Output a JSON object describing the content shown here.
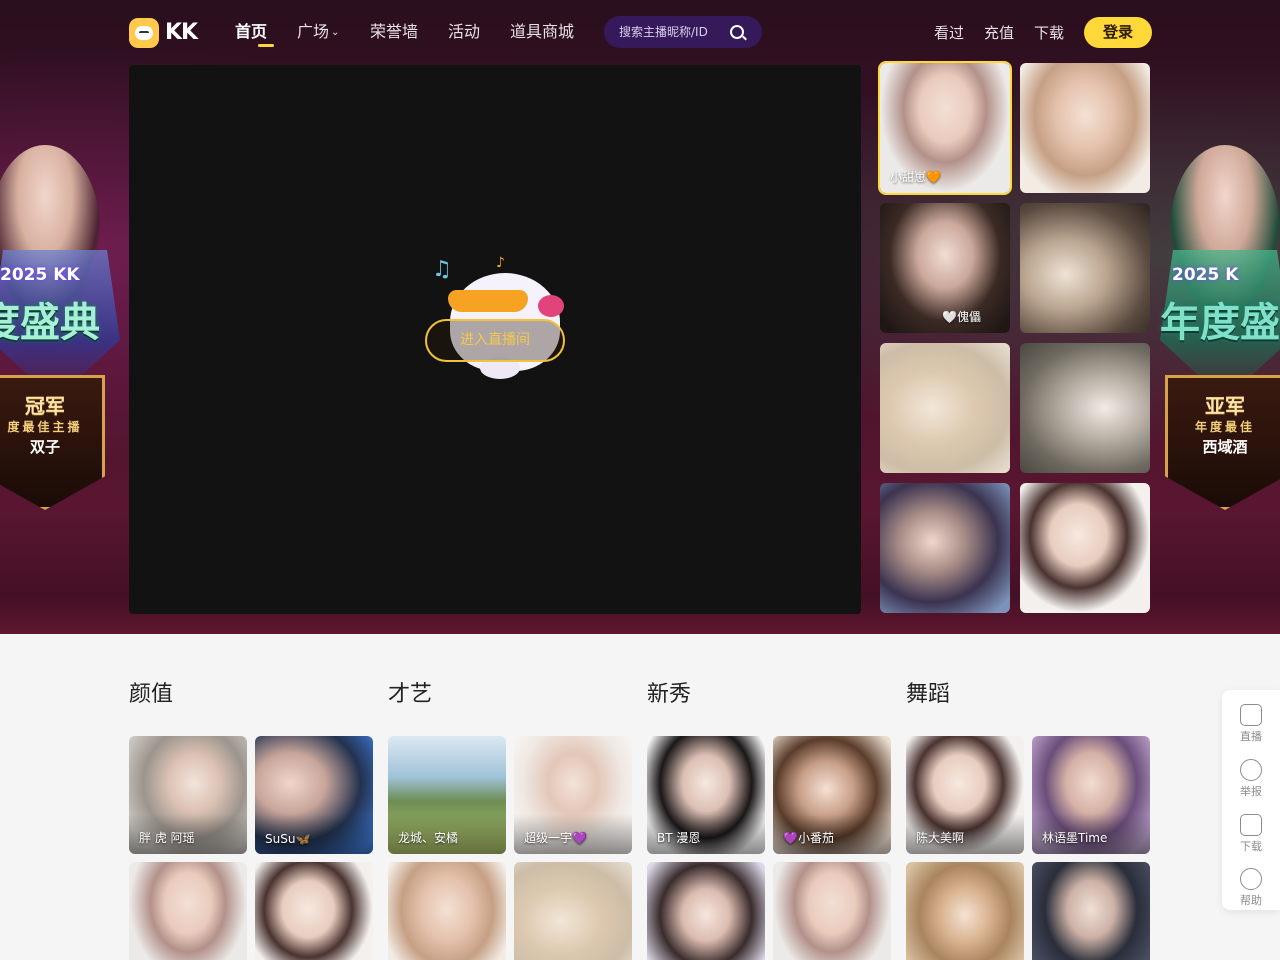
{
  "header": {
    "logo_text": "KK",
    "nav": [
      {
        "label": "首页",
        "active": true
      },
      {
        "label": "广场",
        "has_dropdown": true
      },
      {
        "label": "荣誉墙"
      },
      {
        "label": "活动"
      },
      {
        "label": "道具商城"
      }
    ],
    "search_placeholder": "搜索主播昵称/ID",
    "links": [
      "看过",
      "充值",
      "下载"
    ],
    "login_label": "登录"
  },
  "banners": {
    "left": {
      "year": "2025 KK",
      "event": "度盛典",
      "rank": "冠军",
      "title": "度最佳主播",
      "name": "双子"
    },
    "right": {
      "year": "2025 K",
      "event": "年度盛",
      "rank": "亚军",
      "title": "年度最佳",
      "name": "西域酒"
    }
  },
  "player": {
    "enter_label": "进入直播间"
  },
  "live_thumbs": [
    {
      "caption": "小甜崽🧡",
      "active": true,
      "tone": "p-light"
    },
    {
      "caption": "",
      "tone": "p-warm"
    },
    {
      "caption": "🤍傀儡",
      "tone": "p-dark"
    },
    {
      "caption": "",
      "tone": "p-room"
    },
    {
      "caption": "",
      "tone": "p-beige"
    },
    {
      "caption": "",
      "tone": "p-stone"
    },
    {
      "caption": "",
      "tone": "p-dusk"
    },
    {
      "caption": "",
      "tone": "p-white"
    }
  ],
  "categories": [
    {
      "title": "颜值",
      "cards": [
        {
          "caption": "胖 虎 阿瑶",
          "tone": "p-grey"
        },
        {
          "caption": "SuSu🦋",
          "tone": "p-sky"
        },
        {
          "caption": "",
          "tone": "p-light"
        },
        {
          "caption": "",
          "tone": "p-white"
        }
      ]
    },
    {
      "title": "才艺",
      "cards": [
        {
          "caption": "龙城、安橘",
          "tone": "p-field"
        },
        {
          "caption": "超级一宇💜",
          "tone": "p-studio"
        },
        {
          "caption": "",
          "tone": "p-warm"
        },
        {
          "caption": "",
          "tone": "p-beige"
        }
      ]
    },
    {
      "title": "新秀",
      "cards": [
        {
          "caption": "BT 漫恩",
          "tone": "p-mono"
        },
        {
          "caption": "💜小番茄",
          "tone": "p-cozy"
        },
        {
          "caption": "",
          "tone": "p-snow"
        },
        {
          "caption": "",
          "tone": "p-light"
        }
      ]
    },
    {
      "title": "舞蹈",
      "cards": [
        {
          "caption": "陈大美啊",
          "tone": "p-white"
        },
        {
          "caption": "林语墨Time",
          "tone": "p-violet"
        },
        {
          "caption": "",
          "tone": "p-gold"
        },
        {
          "caption": "",
          "tone": "p-noir"
        }
      ]
    }
  ],
  "tool_rail": [
    {
      "label": "直播",
      "icon": "camera-icon"
    },
    {
      "label": "举报",
      "icon": "report-icon"
    },
    {
      "label": "下载",
      "icon": "phone-icon"
    },
    {
      "label": "帮助",
      "icon": "help-icon"
    }
  ]
}
